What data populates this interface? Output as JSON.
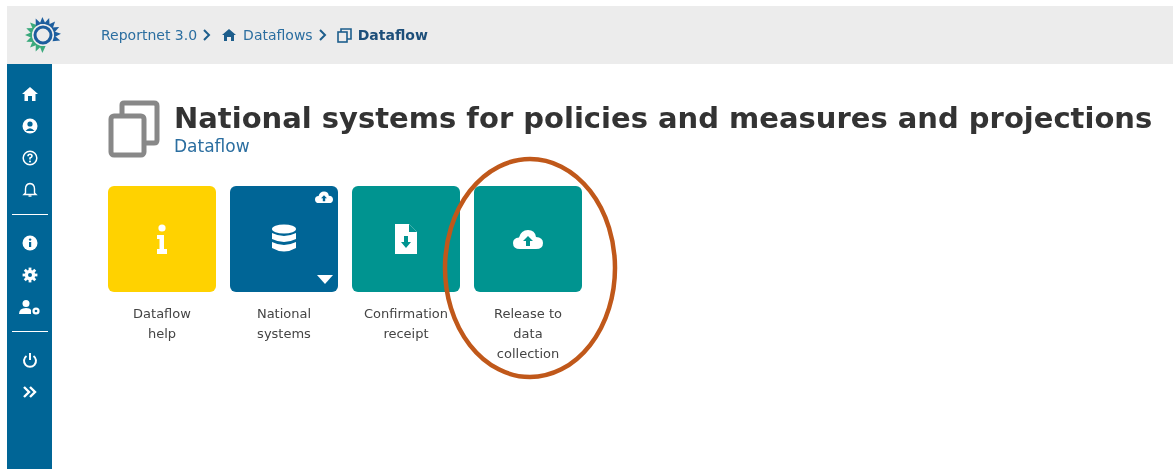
{
  "breadcrumb": [
    {
      "label": "Reportnet 3.0",
      "kind": "plain",
      "current": false
    },
    {
      "label": "Dataflows",
      "kind": "home",
      "current": false
    },
    {
      "label": "Dataflow",
      "kind": "dataflow",
      "current": true
    }
  ],
  "page": {
    "title": "National systems for policies and measures and projections",
    "subtitle": "Dataflow"
  },
  "tiles": [
    {
      "kind": "help",
      "label": "Dataflow help",
      "highlighted": false
    },
    {
      "kind": "dataset",
      "label": "National systems",
      "highlighted": false
    },
    {
      "kind": "receipt",
      "label": "Confirmation receipt",
      "highlighted": false
    },
    {
      "kind": "release",
      "label": "Release to data collection",
      "highlighted": true
    }
  ]
}
